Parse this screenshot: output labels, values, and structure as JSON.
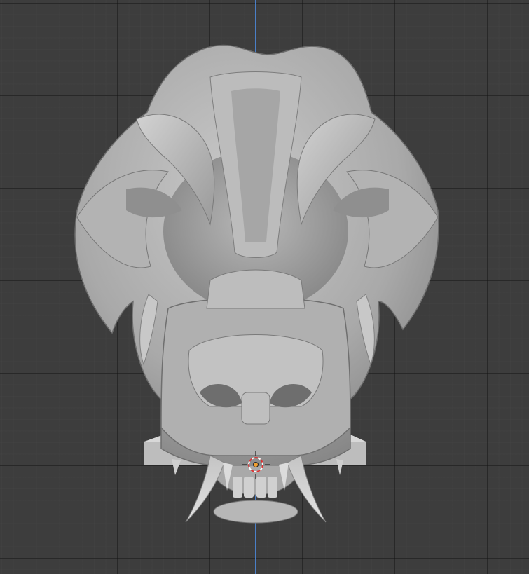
{
  "viewport": {
    "background": "#3d3d3d",
    "x_axis_color": "#c7444f",
    "y_axis_color": "#4a7fc7",
    "object": "sculpted-creature-skull-mesh",
    "cursor_color": "#e8a05a"
  }
}
